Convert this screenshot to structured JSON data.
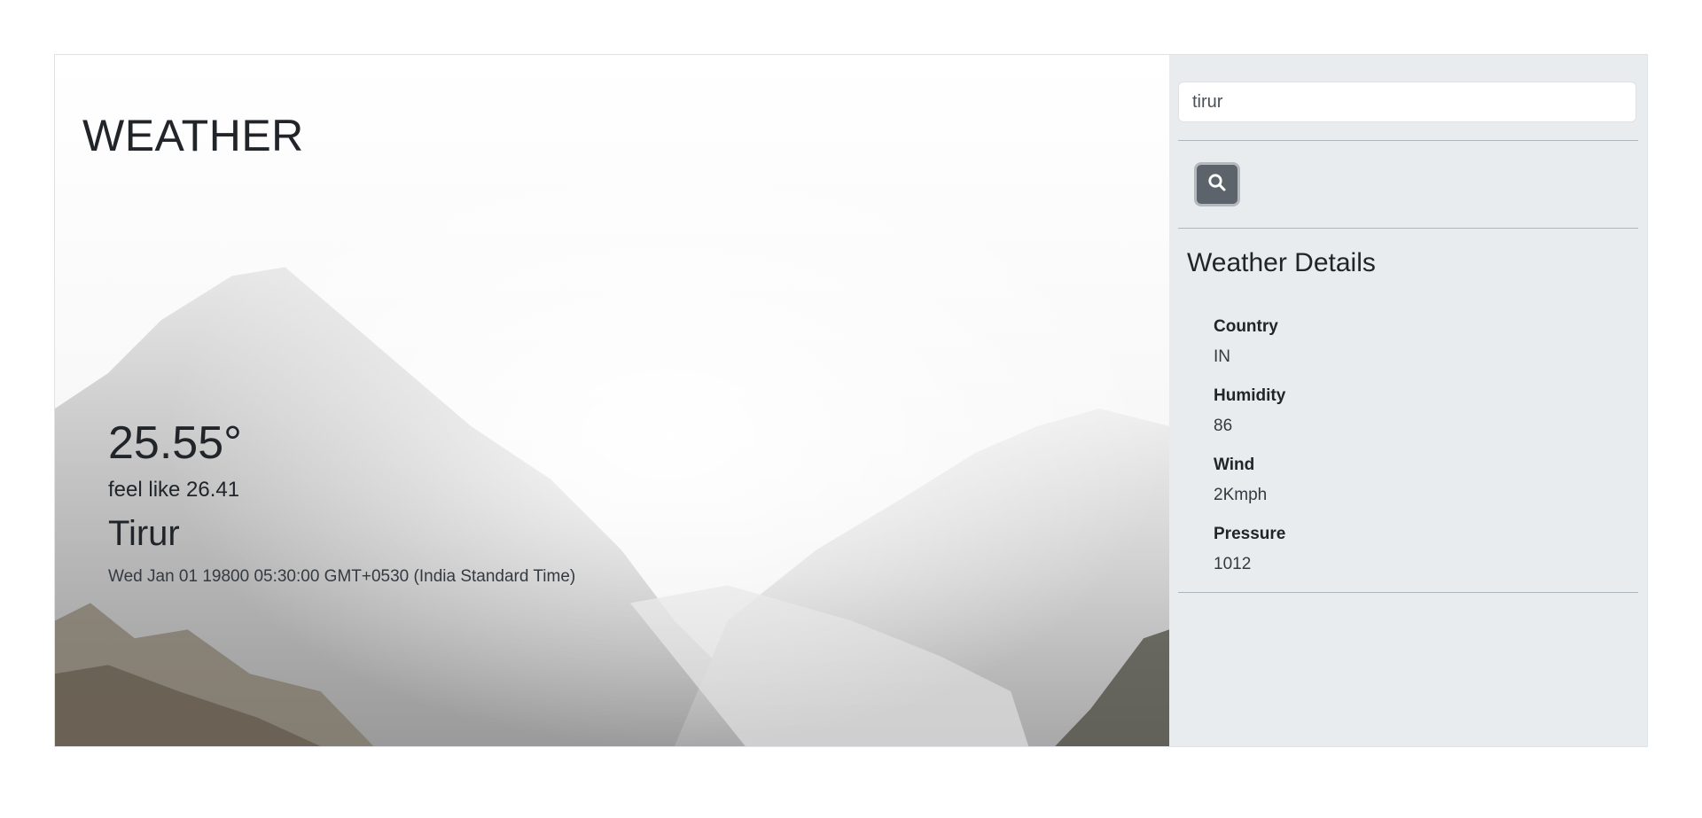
{
  "app": {
    "title": "WEATHER"
  },
  "current": {
    "temperature": "25.55°",
    "feels_like": "feel like 26.41",
    "city": "Tirur",
    "datetime": "Wed Jan 01 19800 05:30:00 GMT+0530 (India Standard Time)"
  },
  "search": {
    "value": "tirur",
    "button_icon": "search-icon"
  },
  "details": {
    "title": "Weather Details",
    "items": [
      {
        "label": "Country",
        "value": "IN"
      },
      {
        "label": "Humidity",
        "value": "86"
      },
      {
        "label": "Wind",
        "value": "2Kmph"
      },
      {
        "label": "Pressure",
        "value": "1012"
      }
    ]
  },
  "colors": {
    "sidebar_bg": "#e9ecef",
    "button_bg": "#5c636a",
    "text": "#212529"
  }
}
